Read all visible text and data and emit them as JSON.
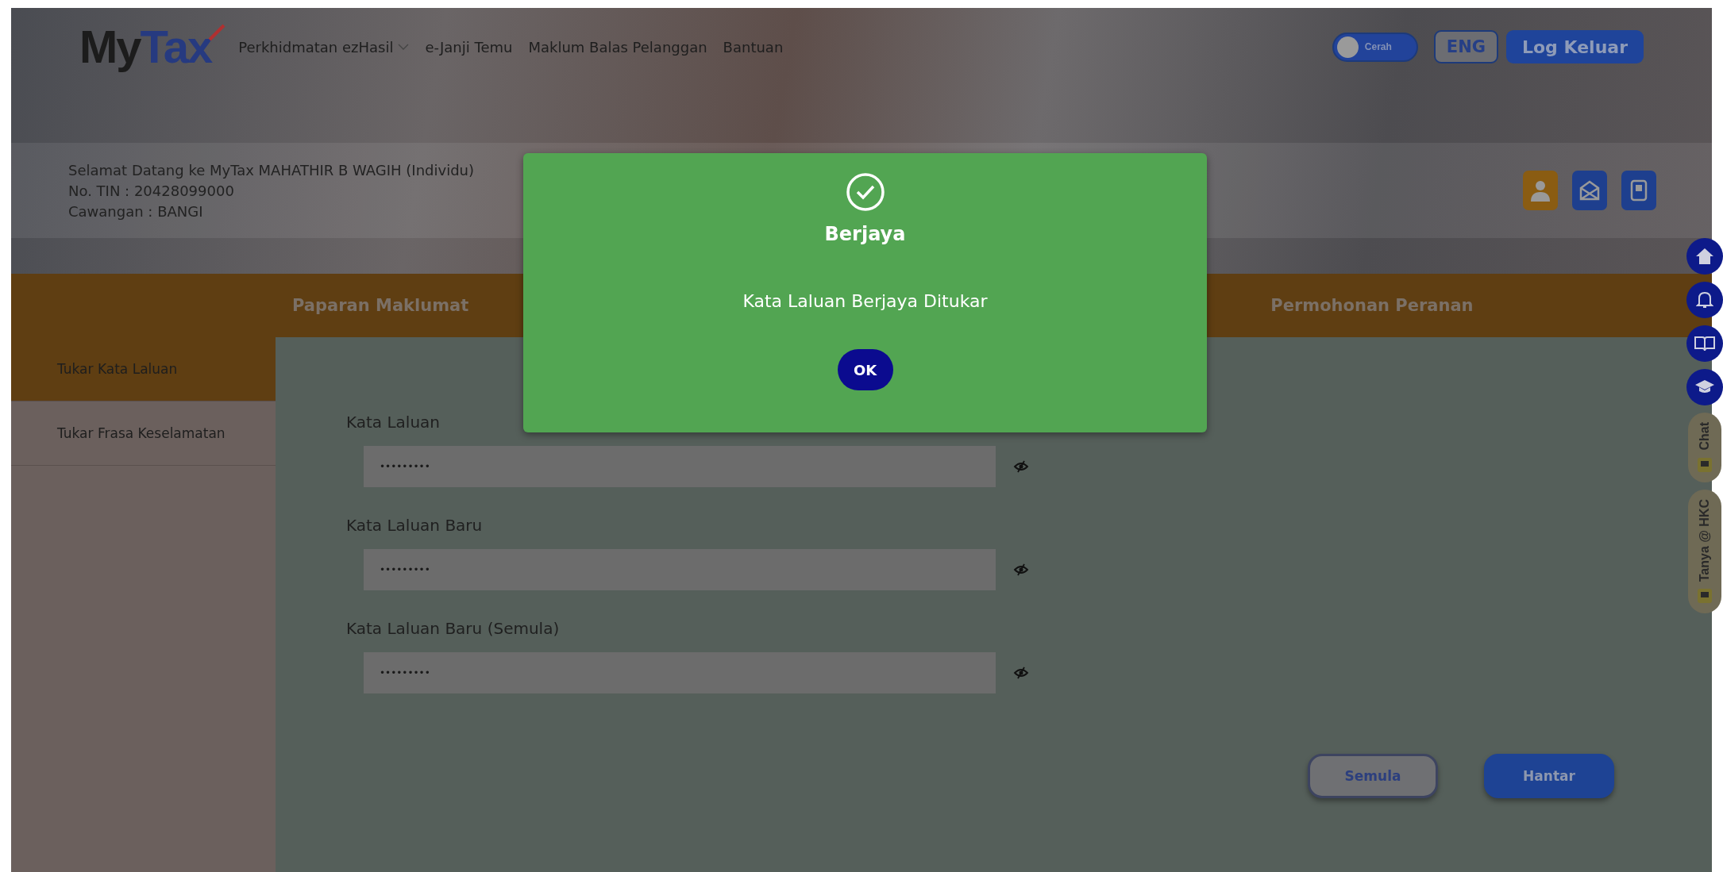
{
  "header": {
    "logo": [
      "My",
      "Tax"
    ],
    "nav": [
      {
        "label": "Perkhidmatan ezHasil",
        "dropdown": true
      },
      {
        "label": "e-Janji Temu",
        "dropdown": false
      },
      {
        "label": "Maklum Balas Pelanggan",
        "dropdown": false
      },
      {
        "label": "Bantuan",
        "dropdown": false
      }
    ],
    "theme_toggle": {
      "label": "Cerah",
      "on": false
    },
    "language_button": "ENG",
    "logout_button": "Log Keluar"
  },
  "welcome": [
    "Selamat Datang ke MyTax MAHATHIR B WAGIH (Individu)",
    "No. TIN : 20428099000",
    "Cawangan : BANGI"
  ],
  "tabs": [
    {
      "label": "Paparan Maklumat",
      "selected": false
    },
    {
      "label": "Permohonan Peranan",
      "selected": false
    }
  ],
  "sidebar": [
    {
      "label": "Tukar Kata Laluan",
      "selected": true
    },
    {
      "label": "Tukar Frasa Keselamatan",
      "selected": false
    }
  ],
  "form": {
    "fields": [
      {
        "label": "Kata Laluan",
        "value": "•••••••••"
      },
      {
        "label": "Kata Laluan Baru",
        "value": "•••••••••"
      },
      {
        "label": "Kata Laluan Baru (Semula)",
        "value": "•••••••••"
      }
    ],
    "buttons": [
      {
        "label": "Semula",
        "kind": "secondary"
      },
      {
        "label": "Hantar",
        "kind": "primary"
      }
    ]
  },
  "side_dock": {
    "tabs": [
      "Chat",
      "Tanya @ HKC"
    ]
  },
  "dialog": {
    "title": "Berjaya",
    "message": "Kata Laluan Berjaya Ditukar",
    "button": "OK"
  }
}
